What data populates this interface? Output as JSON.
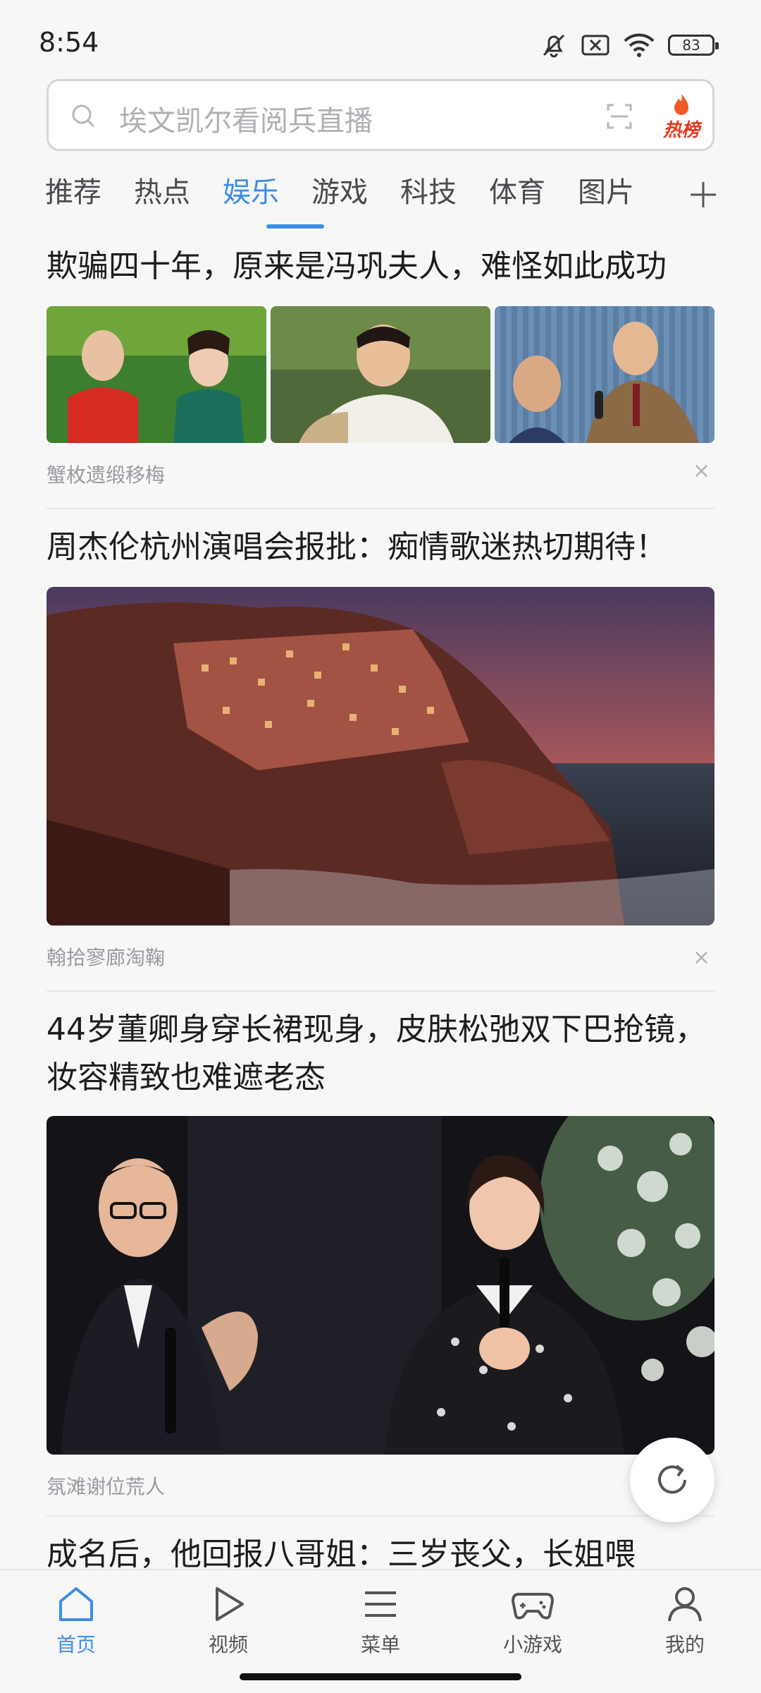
{
  "status_bar": {
    "time": "8:54",
    "battery": "83"
  },
  "search": {
    "placeholder": "埃文凯尔看阅兵直播",
    "hot_label": "热榜"
  },
  "tabs": [
    {
      "label": "推荐"
    },
    {
      "label": "热点"
    },
    {
      "label": "娱乐"
    },
    {
      "label": "游戏"
    },
    {
      "label": "科技"
    },
    {
      "label": "体育"
    },
    {
      "label": "图片"
    }
  ],
  "active_tab": "娱乐",
  "articles": [
    {
      "title": "欺骗四十年，原来是冯巩夫人，难怪如此成功",
      "source": "蟹枚遗缎移梅"
    },
    {
      "title": "周杰伦杭州演唱会报批：痴情歌迷热切期待！",
      "source": "翰拾寥廊淘鞠"
    },
    {
      "title": "44岁董卿身穿长裙现身，皮肤松弛双下巴抢镜，妆容精致也难遮老态",
      "source": "氛滩谢位荒人"
    },
    {
      "title": "成名后，他回报八哥姐：三岁丧父，长姐喂"
    }
  ],
  "close_glyph": "×",
  "bottom_nav": [
    {
      "label": "首页"
    },
    {
      "label": "视频"
    },
    {
      "label": "菜单"
    },
    {
      "label": "小游戏"
    },
    {
      "label": "我的"
    }
  ],
  "colors": {
    "accent": "#3d8de6",
    "hot": "#e5381e"
  }
}
